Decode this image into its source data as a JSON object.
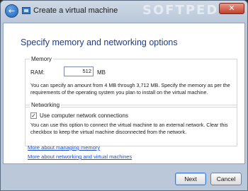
{
  "window": {
    "title": "Create a virtual machine",
    "watermark": "SOFTPEDIA",
    "back_glyph": "←",
    "close_glyph": "✕"
  },
  "page": {
    "heading": "Specify memory and networking options"
  },
  "memory": {
    "group_label": "Memory",
    "ram_label": "RAM:",
    "ram_value": "512",
    "unit": "MB",
    "description": "You can specify an amount from 4 MB through 3,712 MB. Specify the memory as per the requirements of the operating system you plan to install on the virtual machine."
  },
  "networking": {
    "group_label": "Networking",
    "checkbox_label": "Use computer network connections",
    "checkbox_checked": true,
    "check_glyph": "✓",
    "description": "You can use this option to connect the virtual machine to an external network. Clear this checkbox to keep the virtual machine disconnected from the network."
  },
  "links": {
    "managing_memory": "More about managing memory",
    "networking_vms": "More about networking and virtual machines"
  },
  "footer": {
    "next_label": "Next",
    "cancel_label": "Cancel"
  },
  "colors": {
    "heading": "#1e3d8f",
    "link": "#1f4fd1",
    "titlebar": "#cfd9e6"
  }
}
